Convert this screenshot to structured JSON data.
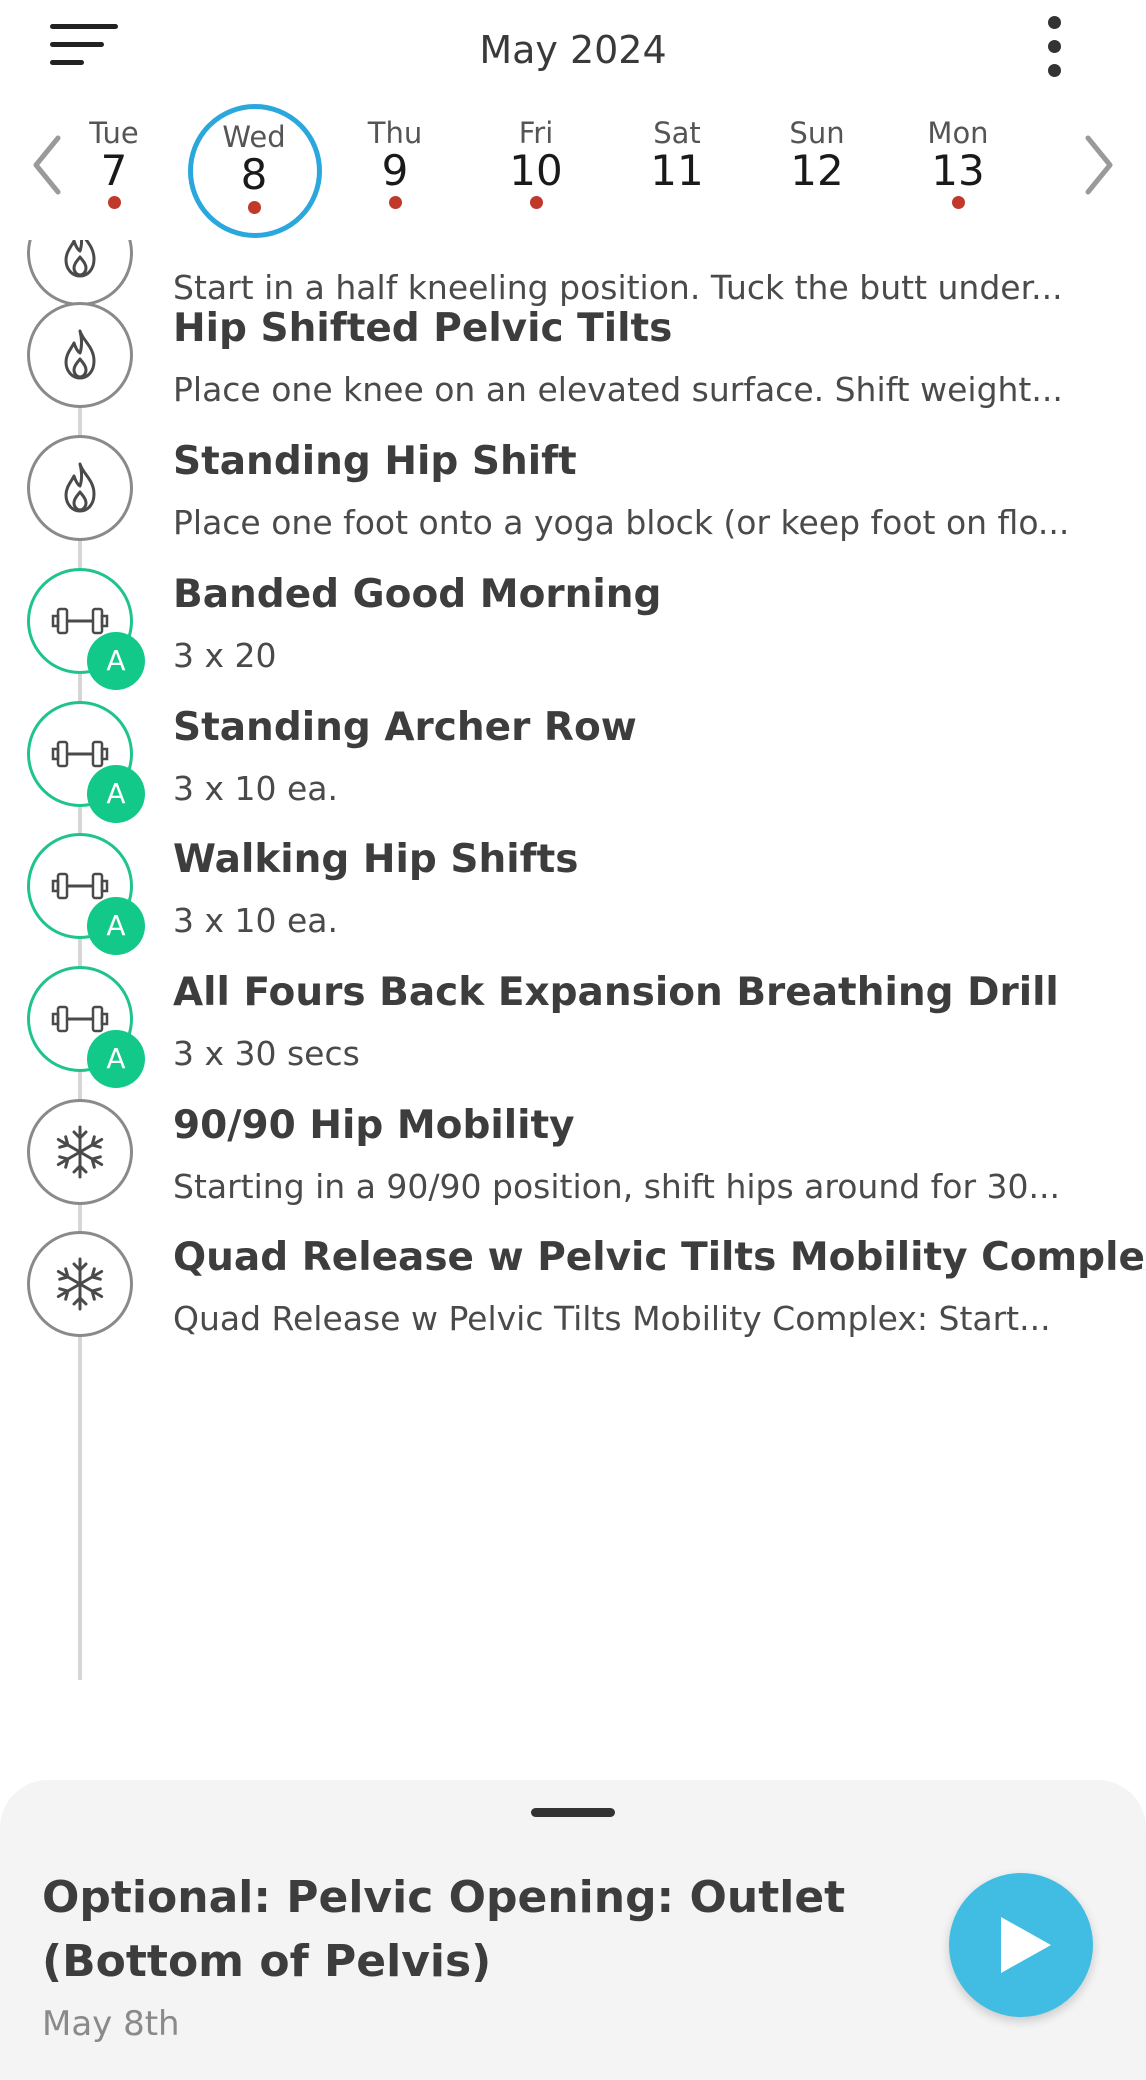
{
  "header": {
    "title": "May 2024",
    "menu_icon": "hamburger-menu-icon",
    "more_icon": "vertical-dots-icon"
  },
  "week": {
    "prev_icon": "chevron-left-icon",
    "next_icon": "chevron-right-icon",
    "days": [
      {
        "dow": "Tue",
        "num": "7",
        "has_dot": true,
        "selected": false
      },
      {
        "dow": "Wed",
        "num": "8",
        "has_dot": true,
        "selected": true
      },
      {
        "dow": "Thu",
        "num": "9",
        "has_dot": true,
        "selected": false
      },
      {
        "dow": "Fri",
        "num": "10",
        "has_dot": true,
        "selected": false
      },
      {
        "dow": "Sat",
        "num": "11",
        "has_dot": false,
        "selected": false
      },
      {
        "dow": "Sun",
        "num": "12",
        "has_dot": false,
        "selected": false
      },
      {
        "dow": "Mon",
        "num": "13",
        "has_dot": true,
        "selected": false
      }
    ]
  },
  "exercises": [
    {
      "title": "",
      "desc": "Start in a half kneeling position.  Tuck the butt under...",
      "icon": "flame-icon",
      "badge": ""
    },
    {
      "title": "Hip Shifted Pelvic Tilts",
      "desc": "Place one knee on an elevated surface.  Shift weight...",
      "icon": "flame-icon",
      "badge": ""
    },
    {
      "title": "Standing Hip Shift",
      "desc": "Place one foot onto a yoga block (or keep foot on flo...",
      "icon": "flame-icon",
      "badge": ""
    },
    {
      "title": "Banded Good Morning",
      "desc": "3 x 20",
      "icon": "dumbbell-icon",
      "badge": "A"
    },
    {
      "title": "Standing Archer Row",
      "desc": "3 x 10 ea.",
      "icon": "dumbbell-icon",
      "badge": "A"
    },
    {
      "title": "Walking Hip Shifts",
      "desc": "3 x 10 ea.",
      "icon": "dumbbell-icon",
      "badge": "A"
    },
    {
      "title": "All Fours Back Expansion Breathing Drill",
      "desc": "3 x 30 secs",
      "icon": "dumbbell-icon",
      "badge": "A"
    },
    {
      "title": "90/90 Hip Mobility",
      "desc": "Starting in a 90/90 position, shift hips around for 30...",
      "icon": "snowflake-icon",
      "badge": ""
    },
    {
      "title": "Quad Release w Pelvic Tilts Mobility Complex",
      "desc": "Quad Release w Pelvic Tilts Mobility Complex: Start...",
      "icon": "snowflake-icon",
      "badge": ""
    }
  ],
  "bottom_sheet": {
    "title": "Optional: Pelvic Opening: Outlet (Bottom of Pelvis)",
    "date": "May 8th",
    "play_icon": "play-icon"
  },
  "colors": {
    "selected_ring": "#2aa7dd",
    "event_dot": "#c0392b",
    "accessory_green": "#12c989",
    "play_button": "#41bde3"
  }
}
